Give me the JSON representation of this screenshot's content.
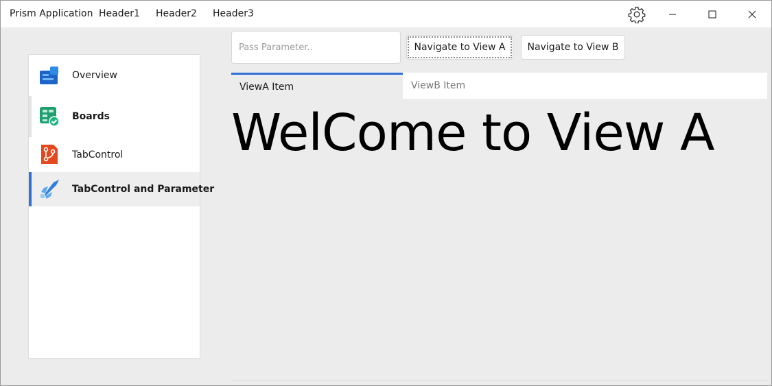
{
  "window": {
    "app_title": "Prism Application",
    "menu": [
      "Header1",
      "Header2",
      "Header3"
    ],
    "controls": {
      "settings_icon": "gear-icon",
      "minimize_icon": "minimize-icon",
      "maximize_icon": "maximize-icon",
      "close_icon": "close-icon"
    }
  },
  "sidebar": {
    "items": [
      {
        "label": "Overview",
        "icon": "overview-icon",
        "bold": false,
        "selected": false
      },
      {
        "label": "Boards",
        "icon": "boards-icon",
        "bold": true,
        "selected": false
      },
      {
        "label": "TabControl",
        "icon": "repo-icon",
        "bold": false,
        "selected": false
      },
      {
        "label": "TabControl and Parameter",
        "icon": "pipelines-icon",
        "bold": true,
        "selected": true
      }
    ]
  },
  "toolbar": {
    "param_placeholder": "Pass Parameter..",
    "param_value": "",
    "nav_a_label": "Navigate to View A",
    "nav_b_label": "Navigate to View B"
  },
  "tabs": [
    {
      "label": "ViewA Item",
      "active": true
    },
    {
      "label": "ViewB Item",
      "active": false
    }
  ],
  "content": {
    "welcome_text": "WelCome to View A"
  },
  "colors": {
    "accent": "#2f6fd8",
    "background": "#ececec"
  }
}
